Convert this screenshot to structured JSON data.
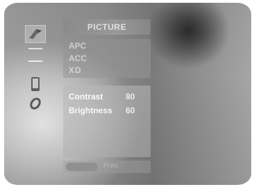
{
  "menu": {
    "title": "PICTURE",
    "items": [
      {
        "label": "APC"
      },
      {
        "label": "ACC"
      },
      {
        "label": "XD"
      }
    ]
  },
  "submenu": {
    "rows": [
      {
        "label": "Contrast",
        "value": "80"
      },
      {
        "label": "Brightness",
        "value": "60"
      }
    ]
  },
  "footer": {
    "label": "Prev."
  },
  "sidebar": {
    "icons": [
      "picture-icon",
      "sound-icon",
      "time-icon",
      "special-icon",
      "screen-icon"
    ]
  }
}
